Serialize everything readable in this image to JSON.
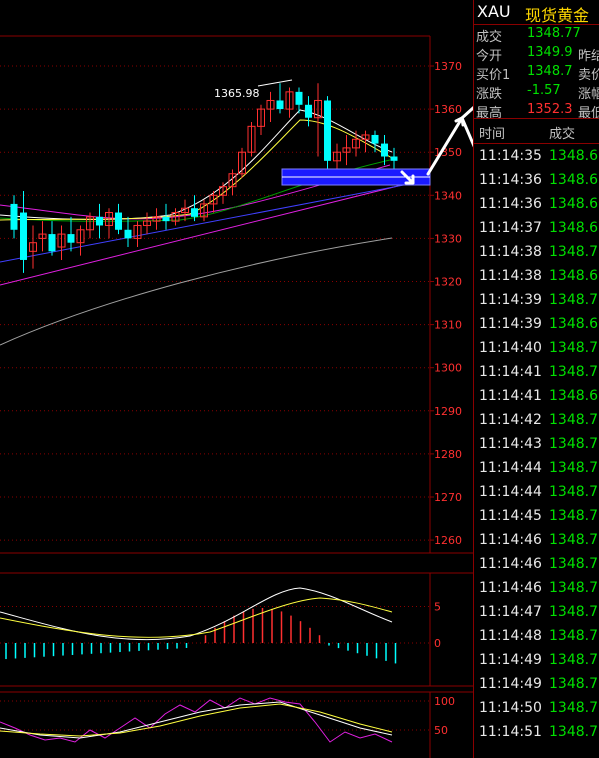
{
  "main_chart": {
    "y_ticks": [
      "1370",
      "1360",
      "1350",
      "1340",
      "1330",
      "1320",
      "1310",
      "1300",
      "1290",
      "1280",
      "1270",
      "1260"
    ],
    "y_values": [
      1370,
      1360,
      1350,
      1340,
      1330,
      1320,
      1310,
      1300,
      1290,
      1280,
      1270,
      1260
    ],
    "y_range": [
      1255,
      1374
    ],
    "high_annotation": "1365.98",
    "candles": [
      {
        "o": 1338,
        "h": 1340,
        "l": 1330,
        "c": 1332,
        "up": false
      },
      {
        "o": 1336,
        "h": 1341,
        "l": 1322,
        "c": 1325,
        "up": false
      },
      {
        "o": 1327,
        "h": 1333,
        "l": 1323,
        "c": 1329,
        "up": true
      },
      {
        "o": 1330,
        "h": 1334,
        "l": 1327,
        "c": 1331,
        "up": true
      },
      {
        "o": 1331,
        "h": 1334,
        "l": 1326,
        "c": 1327,
        "up": false
      },
      {
        "o": 1328,
        "h": 1333,
        "l": 1325,
        "c": 1331,
        "up": true
      },
      {
        "o": 1331,
        "h": 1335,
        "l": 1327,
        "c": 1329,
        "up": false
      },
      {
        "o": 1329,
        "h": 1333,
        "l": 1326,
        "c": 1332,
        "up": true
      },
      {
        "o": 1332,
        "h": 1336,
        "l": 1330,
        "c": 1335,
        "up": true
      },
      {
        "o": 1335,
        "h": 1338,
        "l": 1330,
        "c": 1333,
        "up": false
      },
      {
        "o": 1333,
        "h": 1337,
        "l": 1330,
        "c": 1336,
        "up": true
      },
      {
        "o": 1336,
        "h": 1338,
        "l": 1331,
        "c": 1332,
        "up": false
      },
      {
        "o": 1332,
        "h": 1335,
        "l": 1328,
        "c": 1330,
        "up": false
      },
      {
        "o": 1330,
        "h": 1334,
        "l": 1328,
        "c": 1333,
        "up": true
      },
      {
        "o": 1333,
        "h": 1336,
        "l": 1331,
        "c": 1334,
        "up": true
      },
      {
        "o": 1334,
        "h": 1337,
        "l": 1332,
        "c": 1335,
        "up": true
      },
      {
        "o": 1335,
        "h": 1338,
        "l": 1332,
        "c": 1334,
        "up": false
      },
      {
        "o": 1334,
        "h": 1337,
        "l": 1333,
        "c": 1336,
        "up": true
      },
      {
        "o": 1336,
        "h": 1339,
        "l": 1334,
        "c": 1337,
        "up": true
      },
      {
        "o": 1337,
        "h": 1340,
        "l": 1334,
        "c": 1335,
        "up": false
      },
      {
        "o": 1335,
        "h": 1339,
        "l": 1334,
        "c": 1338,
        "up": true
      },
      {
        "o": 1338,
        "h": 1341,
        "l": 1336,
        "c": 1340,
        "up": true
      },
      {
        "o": 1340,
        "h": 1343,
        "l": 1338,
        "c": 1342,
        "up": true
      },
      {
        "o": 1342,
        "h": 1346,
        "l": 1340,
        "c": 1345,
        "up": true
      },
      {
        "o": 1345,
        "h": 1351,
        "l": 1344,
        "c": 1350,
        "up": true
      },
      {
        "o": 1350,
        "h": 1357,
        "l": 1349,
        "c": 1356,
        "up": true
      },
      {
        "o": 1356,
        "h": 1361,
        "l": 1354,
        "c": 1360,
        "up": true
      },
      {
        "o": 1360,
        "h": 1364,
        "l": 1357,
        "c": 1362,
        "up": true
      },
      {
        "o": 1362,
        "h": 1366,
        "l": 1359,
        "c": 1360,
        "up": false
      },
      {
        "o": 1360,
        "h": 1365,
        "l": 1358,
        "c": 1364,
        "up": true
      },
      {
        "o": 1364,
        "h": 1365,
        "l": 1359,
        "c": 1361,
        "up": false
      },
      {
        "o": 1361,
        "h": 1363,
        "l": 1356,
        "c": 1358,
        "up": false
      },
      {
        "o": 1358,
        "h": 1366,
        "l": 1349,
        "c": 1362,
        "up": true
      },
      {
        "o": 1362,
        "h": 1363,
        "l": 1343,
        "c": 1348,
        "up": false
      },
      {
        "o": 1348,
        "h": 1352,
        "l": 1345,
        "c": 1350,
        "up": true
      },
      {
        "o": 1350,
        "h": 1354,
        "l": 1347,
        "c": 1351,
        "up": true
      },
      {
        "o": 1351,
        "h": 1355,
        "l": 1349,
        "c": 1353,
        "up": true
      },
      {
        "o": 1353,
        "h": 1355,
        "l": 1350,
        "c": 1354,
        "up": true
      },
      {
        "o": 1354,
        "h": 1355,
        "l": 1350,
        "c": 1352,
        "up": false
      },
      {
        "o": 1352,
        "h": 1354,
        "l": 1347,
        "c": 1349,
        "up": false
      },
      {
        "o": 1349,
        "h": 1351,
        "l": 1346,
        "c": 1348,
        "up": false
      }
    ]
  },
  "macd_chart": {
    "y_ticks": [
      "5",
      "0"
    ],
    "y_values": [
      5,
      0
    ]
  },
  "kdj_chart": {
    "y_ticks": [
      "100",
      "50"
    ],
    "y_values": [
      100,
      50
    ]
  },
  "quote_panel": {
    "symbol": "XAU",
    "name": "现货黄金",
    "rows": [
      {
        "label": "成交",
        "value": "1348.77",
        "value_color": "#00e000",
        "extra": ""
      },
      {
        "label": "今开",
        "value": "1349.9",
        "value_color": "#00e000",
        "extra": "昨结"
      },
      {
        "label": "买价1",
        "value": "1348.7",
        "value_color": "#00e000",
        "extra": "卖价"
      },
      {
        "label": "涨跌",
        "value": "-1.57",
        "value_color": "#00e000",
        "extra": "涨幅"
      },
      {
        "label": "最高",
        "value": "1352.3",
        "value_color": "#ff3030",
        "extra": "最低"
      }
    ],
    "ticks_header": {
      "time": "时间",
      "price": "成交"
    },
    "ticks": [
      {
        "time": "11:14:35",
        "price": "1348.6"
      },
      {
        "time": "11:14:36",
        "price": "1348.6"
      },
      {
        "time": "11:14:36",
        "price": "1348.6"
      },
      {
        "time": "11:14:37",
        "price": "1348.6"
      },
      {
        "time": "11:14:38",
        "price": "1348.7"
      },
      {
        "time": "11:14:38",
        "price": "1348.6"
      },
      {
        "time": "11:14:39",
        "price": "1348.7"
      },
      {
        "time": "11:14:39",
        "price": "1348.6"
      },
      {
        "time": "11:14:40",
        "price": "1348.7"
      },
      {
        "time": "11:14:41",
        "price": "1348.7"
      },
      {
        "time": "11:14:41",
        "price": "1348.6"
      },
      {
        "time": "11:14:42",
        "price": "1348.7"
      },
      {
        "time": "11:14:43",
        "price": "1348.7"
      },
      {
        "time": "11:14:44",
        "price": "1348.7"
      },
      {
        "time": "11:14:44",
        "price": "1348.7"
      },
      {
        "time": "11:14:45",
        "price": "1348.7"
      },
      {
        "time": "11:14:46",
        "price": "1348.7"
      },
      {
        "time": "11:14:46",
        "price": "1348.7"
      },
      {
        "time": "11:14:46",
        "price": "1348.7"
      },
      {
        "time": "11:14:47",
        "price": "1348.7"
      },
      {
        "time": "11:14:48",
        "price": "1348.7"
      },
      {
        "time": "11:14:49",
        "price": "1348.7"
      },
      {
        "time": "11:14:49",
        "price": "1348.7"
      },
      {
        "time": "11:14:50",
        "price": "1348.7"
      },
      {
        "time": "11:14:51",
        "price": "1348.7"
      }
    ]
  },
  "colors": {
    "up": "#ff3030",
    "down": "#00ffff",
    "grid": "#8a0000",
    "axis_text": "#ff3030",
    "price_down": "#00e000",
    "highlight_box": "#1a1aff"
  }
}
